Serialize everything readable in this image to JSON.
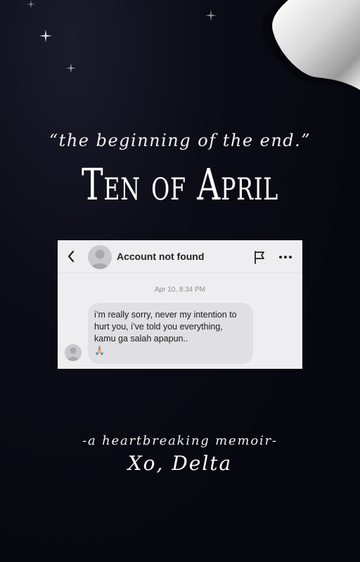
{
  "cover": {
    "tagline": "“the beginning of the end.”",
    "title": "Ten of April",
    "subtitle": "-a heartbreaking memoir-",
    "author": "Xo, Delta"
  },
  "screenshot": {
    "header": {
      "name": "Account not found",
      "icons": [
        "chevron-left-icon",
        "flag-icon",
        "more-icon"
      ]
    },
    "timestamp": "Apr 10, 8:34 PM",
    "message": {
      "text": "i’m really sorry, never my intention to hurt you, i’ve told you everything, kamu ga salah apapun..",
      "emoji": "🙏🏼"
    }
  },
  "colors": {
    "background": "#07080f",
    "text": "#ffffff",
    "chat_background": "#eeeef0",
    "bubble": "#e0e0e4"
  }
}
